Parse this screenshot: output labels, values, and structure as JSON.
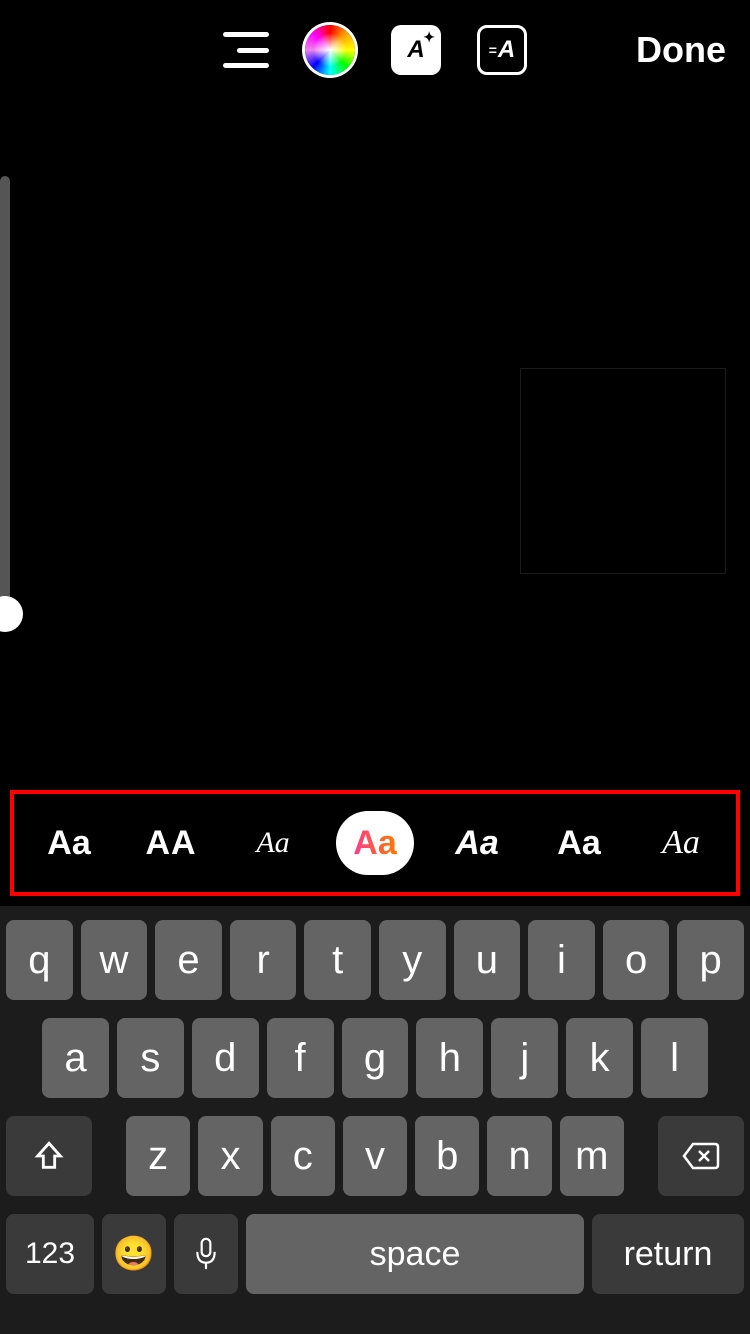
{
  "toolbar": {
    "done_label": "Done",
    "effects_label": "A",
    "animation_label": "A"
  },
  "font_picker": {
    "options": [
      {
        "label": "Aa",
        "style": "classic"
      },
      {
        "label": "AA",
        "style": "caps"
      },
      {
        "label": "Aa",
        "style": "script"
      },
      {
        "label": "Aa",
        "style": "gradient",
        "selected": true
      },
      {
        "label": "Aa",
        "style": "bolditalic"
      },
      {
        "label": "Aa",
        "style": "mixed"
      },
      {
        "label": "Aa",
        "style": "serif"
      }
    ]
  },
  "keyboard": {
    "row1": [
      "q",
      "w",
      "e",
      "r",
      "t",
      "y",
      "u",
      "i",
      "o",
      "p"
    ],
    "row2": [
      "a",
      "s",
      "d",
      "f",
      "g",
      "h",
      "j",
      "k",
      "l"
    ],
    "row3": [
      "z",
      "x",
      "c",
      "v",
      "b",
      "n",
      "m"
    ],
    "numbers_label": "123",
    "space_label": "space",
    "return_label": "return"
  }
}
